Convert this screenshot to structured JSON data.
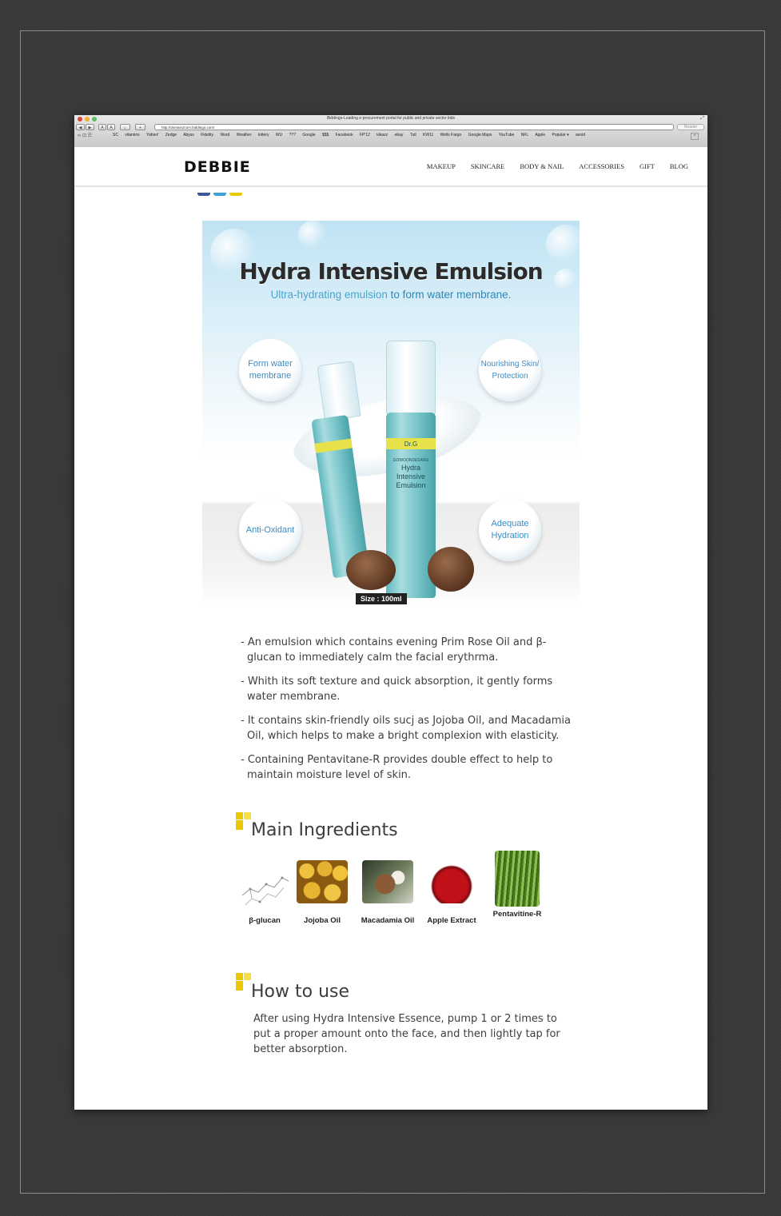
{
  "browser": {
    "window_title": "Biddingo-Leading e-procurement portal for public and private sector bids",
    "url": "http://domain2com.biddingo.com/",
    "reader_label": "Reader",
    "toolbar_buttons": [
      "◀",
      "▶",
      "A",
      "A",
      "⌂",
      "+"
    ],
    "bookmarks": [
      "SC",
      "vitamins",
      "Yahoo!",
      "Zedge",
      "Abyss",
      "Fidelity",
      "Word",
      "Weather",
      "lottery",
      "WU",
      "???",
      "Google",
      "$$$",
      "Facebook",
      "FP'12",
      "kikazz",
      "ebay",
      "Tull",
      "KW11",
      "Wells Fargo",
      "Google Maps",
      "YouTube",
      "NFL",
      "Apple",
      "Popular ▾",
      "avoid"
    ]
  },
  "site": {
    "logo": "DEBBIE",
    "nav": [
      "MAKEUP",
      "SKINCARE",
      "BODY & NAIL",
      "ACCESSORIES",
      "GIFT",
      "BLOG"
    ]
  },
  "hero": {
    "title": "Hydra Intensive Emulsion",
    "subtitle_a": "Ultra-hydrating emulsion",
    "subtitle_b": " to form water membrane.",
    "features": {
      "top_left": "Form water membrane",
      "top_right": "Nourishing Skin/ Protection",
      "bottom_left": "Anti-Oxidant",
      "bottom_right": "Adequate Hydration"
    },
    "bottle_brand": "Dr.G",
    "bottle_name": "Hydra Intensive Emulsion",
    "bottle_maker": "GOWOONSESANG",
    "size": "Size : 100ml"
  },
  "description": [
    "- An emulsion which contains evening Prim Rose Oil and β-glucan to immediately calm the facial erythrma.",
    "- Whith its soft texture and quick absorption, it gently forms water membrane.",
    "- It contains skin-friendly oils sucj as Jojoba Oil, and Macadamia Oil, which helps to make a bright complexion with elasticity.",
    "- Containing Pentavitane-R provides double effect to help to maintain moisture level of skin."
  ],
  "ingredients": {
    "title": "Main Ingredients",
    "items": [
      "β-glucan",
      "Jojoba Oil",
      "Macadamia Oil",
      "Apple Extract",
      "Pentavitine-R"
    ]
  },
  "how_to_use": {
    "title": "How to use",
    "text": "After using Hydra Intensive Essence, pump 1 or 2 times to put a proper amount onto the face, and then lightly tap for better absorption."
  },
  "colors": {
    "accent_blue": "#4aa6cf",
    "section_icon": "#e8c800",
    "text": "#3d3d3d"
  }
}
